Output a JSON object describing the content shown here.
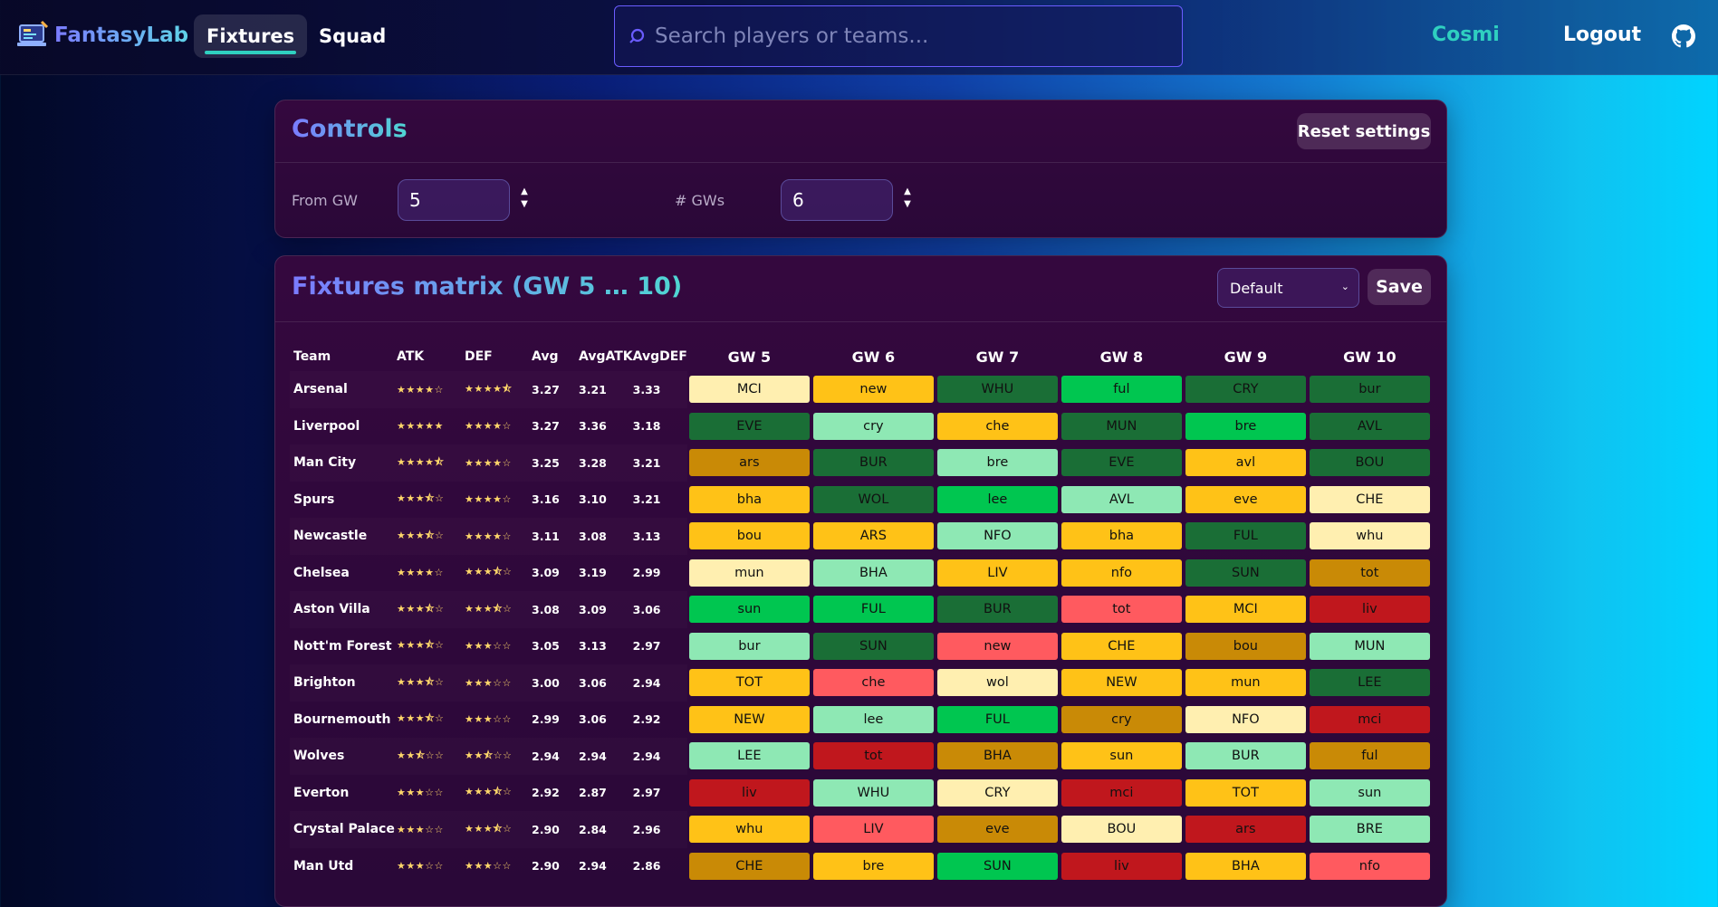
{
  "app": {
    "name": "FantasyLab"
  },
  "nav": {
    "tabs": [
      {
        "label": "Fixtures",
        "active": true
      },
      {
        "label": "Squad",
        "active": false
      }
    ]
  },
  "search": {
    "placeholder": "Search players or teams..."
  },
  "user": {
    "name": "Cosmi",
    "logout_label": "Logout"
  },
  "controls": {
    "title": "Controls",
    "reset_label": "Reset settings",
    "from_gw_label": "From GW",
    "from_gw_value": "5",
    "num_gws_label": "# GWs",
    "num_gws_value": "6"
  },
  "matrix": {
    "title": "Fixtures matrix (GW 5 … 10)",
    "preset_value": "Default",
    "save_label": "Save",
    "columns": [
      "Team",
      "ATK",
      "DEF",
      "Avg",
      "AvgATK",
      "AvgDEF",
      "GW 5",
      "GW 6",
      "GW 7",
      "GW 8",
      "GW 9",
      "GW 10"
    ],
    "rows": [
      {
        "team": "Arsenal",
        "atk": "★★★★☆",
        "def": "★★★★⯪",
        "avg": "3.27",
        "avgatk": "3.21",
        "avgdef": "3.33",
        "fixtures": [
          {
            "t": "MCI",
            "d": 4
          },
          {
            "t": "new",
            "d": 5
          },
          {
            "t": "WHU",
            "d": 1
          },
          {
            "t": "ful",
            "d": 2
          },
          {
            "t": "CRY",
            "d": 1
          },
          {
            "t": "bur",
            "d": 1
          }
        ]
      },
      {
        "team": "Liverpool",
        "atk": "★★★★★",
        "def": "★★★★☆",
        "avg": "3.27",
        "avgatk": "3.36",
        "avgdef": "3.18",
        "fixtures": [
          {
            "t": "EVE",
            "d": 1
          },
          {
            "t": "cry",
            "d": 3
          },
          {
            "t": "che",
            "d": 5
          },
          {
            "t": "MUN",
            "d": 1
          },
          {
            "t": "bre",
            "d": 2
          },
          {
            "t": "AVL",
            "d": 1
          }
        ]
      },
      {
        "team": "Man City",
        "atk": "★★★★⯪",
        "def": "★★★★☆",
        "avg": "3.25",
        "avgatk": "3.28",
        "avgdef": "3.21",
        "fixtures": [
          {
            "t": "ars",
            "d": 6
          },
          {
            "t": "BUR",
            "d": 1
          },
          {
            "t": "bre",
            "d": 3
          },
          {
            "t": "EVE",
            "d": 1
          },
          {
            "t": "avl",
            "d": 5
          },
          {
            "t": "BOU",
            "d": 1
          }
        ]
      },
      {
        "team": "Spurs",
        "atk": "★★★⯪☆",
        "def": "★★★★☆",
        "avg": "3.16",
        "avgatk": "3.10",
        "avgdef": "3.21",
        "fixtures": [
          {
            "t": "bha",
            "d": 5
          },
          {
            "t": "WOL",
            "d": 1
          },
          {
            "t": "lee",
            "d": 2
          },
          {
            "t": "AVL",
            "d": 3
          },
          {
            "t": "eve",
            "d": 5
          },
          {
            "t": "CHE",
            "d": 4
          }
        ]
      },
      {
        "team": "Newcastle",
        "atk": "★★★⯪☆",
        "def": "★★★★☆",
        "avg": "3.11",
        "avgatk": "3.08",
        "avgdef": "3.13",
        "fixtures": [
          {
            "t": "bou",
            "d": 5
          },
          {
            "t": "ARS",
            "d": 5
          },
          {
            "t": "NFO",
            "d": 3
          },
          {
            "t": "bha",
            "d": 5
          },
          {
            "t": "FUL",
            "d": 1
          },
          {
            "t": "whu",
            "d": 4
          }
        ]
      },
      {
        "team": "Chelsea",
        "atk": "★★★★☆",
        "def": "★★★⯪☆",
        "avg": "3.09",
        "avgatk": "3.19",
        "avgdef": "2.99",
        "fixtures": [
          {
            "t": "mun",
            "d": 4
          },
          {
            "t": "BHA",
            "d": 3
          },
          {
            "t": "LIV",
            "d": 5
          },
          {
            "t": "nfo",
            "d": 5
          },
          {
            "t": "SUN",
            "d": 1
          },
          {
            "t": "tot",
            "d": 6
          }
        ]
      },
      {
        "team": "Aston Villa",
        "atk": "★★★⯪☆",
        "def": "★★★⯪☆",
        "avg": "3.08",
        "avgatk": "3.09",
        "avgdef": "3.06",
        "fixtures": [
          {
            "t": "sun",
            "d": 2
          },
          {
            "t": "FUL",
            "d": 2
          },
          {
            "t": "BUR",
            "d": 1
          },
          {
            "t": "tot",
            "d": 7
          },
          {
            "t": "MCI",
            "d": 5
          },
          {
            "t": "liv",
            "d": 8
          }
        ]
      },
      {
        "team": "Nott'm Forest",
        "atk": "★★★⯪☆",
        "def": "★★★☆☆",
        "avg": "3.05",
        "avgatk": "3.13",
        "avgdef": "2.97",
        "fixtures": [
          {
            "t": "bur",
            "d": 3
          },
          {
            "t": "SUN",
            "d": 1
          },
          {
            "t": "new",
            "d": 7
          },
          {
            "t": "CHE",
            "d": 5
          },
          {
            "t": "bou",
            "d": 6
          },
          {
            "t": "MUN",
            "d": 3
          }
        ]
      },
      {
        "team": "Brighton",
        "atk": "★★★⯪☆",
        "def": "★★★☆☆",
        "avg": "3.00",
        "avgatk": "3.06",
        "avgdef": "2.94",
        "fixtures": [
          {
            "t": "TOT",
            "d": 5
          },
          {
            "t": "che",
            "d": 7
          },
          {
            "t": "wol",
            "d": 4
          },
          {
            "t": "NEW",
            "d": 5
          },
          {
            "t": "mun",
            "d": 5
          },
          {
            "t": "LEE",
            "d": 1
          }
        ]
      },
      {
        "team": "Bournemouth",
        "atk": "★★★⯪☆",
        "def": "★★★☆☆",
        "avg": "2.99",
        "avgatk": "3.06",
        "avgdef": "2.92",
        "fixtures": [
          {
            "t": "NEW",
            "d": 5
          },
          {
            "t": "lee",
            "d": 3
          },
          {
            "t": "FUL",
            "d": 2
          },
          {
            "t": "cry",
            "d": 6
          },
          {
            "t": "NFO",
            "d": 4
          },
          {
            "t": "mci",
            "d": 8
          }
        ]
      },
      {
        "team": "Wolves",
        "atk": "★★⯪☆☆",
        "def": "★★⯪☆☆",
        "avg": "2.94",
        "avgatk": "2.94",
        "avgdef": "2.94",
        "fixtures": [
          {
            "t": "LEE",
            "d": 3
          },
          {
            "t": "tot",
            "d": 8
          },
          {
            "t": "BHA",
            "d": 6
          },
          {
            "t": "sun",
            "d": 5
          },
          {
            "t": "BUR",
            "d": 3
          },
          {
            "t": "ful",
            "d": 6
          }
        ]
      },
      {
        "team": "Everton",
        "atk": "★★★☆☆",
        "def": "★★★⯪☆",
        "avg": "2.92",
        "avgatk": "2.87",
        "avgdef": "2.97",
        "fixtures": [
          {
            "t": "liv",
            "d": 8
          },
          {
            "t": "WHU",
            "d": 3
          },
          {
            "t": "CRY",
            "d": 4
          },
          {
            "t": "mci",
            "d": 8
          },
          {
            "t": "TOT",
            "d": 5
          },
          {
            "t": "sun",
            "d": 3
          }
        ]
      },
      {
        "team": "Crystal Palace",
        "atk": "★★★☆☆",
        "def": "★★★⯪☆",
        "avg": "2.90",
        "avgatk": "2.84",
        "avgdef": "2.96",
        "fixtures": [
          {
            "t": "whu",
            "d": 5
          },
          {
            "t": "LIV",
            "d": 7
          },
          {
            "t": "eve",
            "d": 6
          },
          {
            "t": "BOU",
            "d": 4
          },
          {
            "t": "ars",
            "d": 8
          },
          {
            "t": "BRE",
            "d": 3
          }
        ]
      },
      {
        "team": "Man Utd",
        "atk": "★★★☆☆",
        "def": "★★★☆☆",
        "avg": "2.90",
        "avgatk": "2.94",
        "avgdef": "2.86",
        "fixtures": [
          {
            "t": "CHE",
            "d": 6
          },
          {
            "t": "bre",
            "d": 5
          },
          {
            "t": "SUN",
            "d": 2
          },
          {
            "t": "liv",
            "d": 8
          },
          {
            "t": "BHA",
            "d": 5
          },
          {
            "t": "nfo",
            "d": 7
          }
        ]
      }
    ]
  },
  "colors": {
    "accent_teal": "#2fd0c0",
    "difficulty_scale": [
      "#1a6e36",
      "#00c650",
      "#8ee8b4",
      "#ffefb0",
      "#ffc217",
      "#c98a06",
      "#ff5a5f",
      "#c0171d"
    ]
  },
  "icons": {
    "logo": "laptop-logo-icon",
    "search": "search-icon",
    "github": "github-icon"
  }
}
